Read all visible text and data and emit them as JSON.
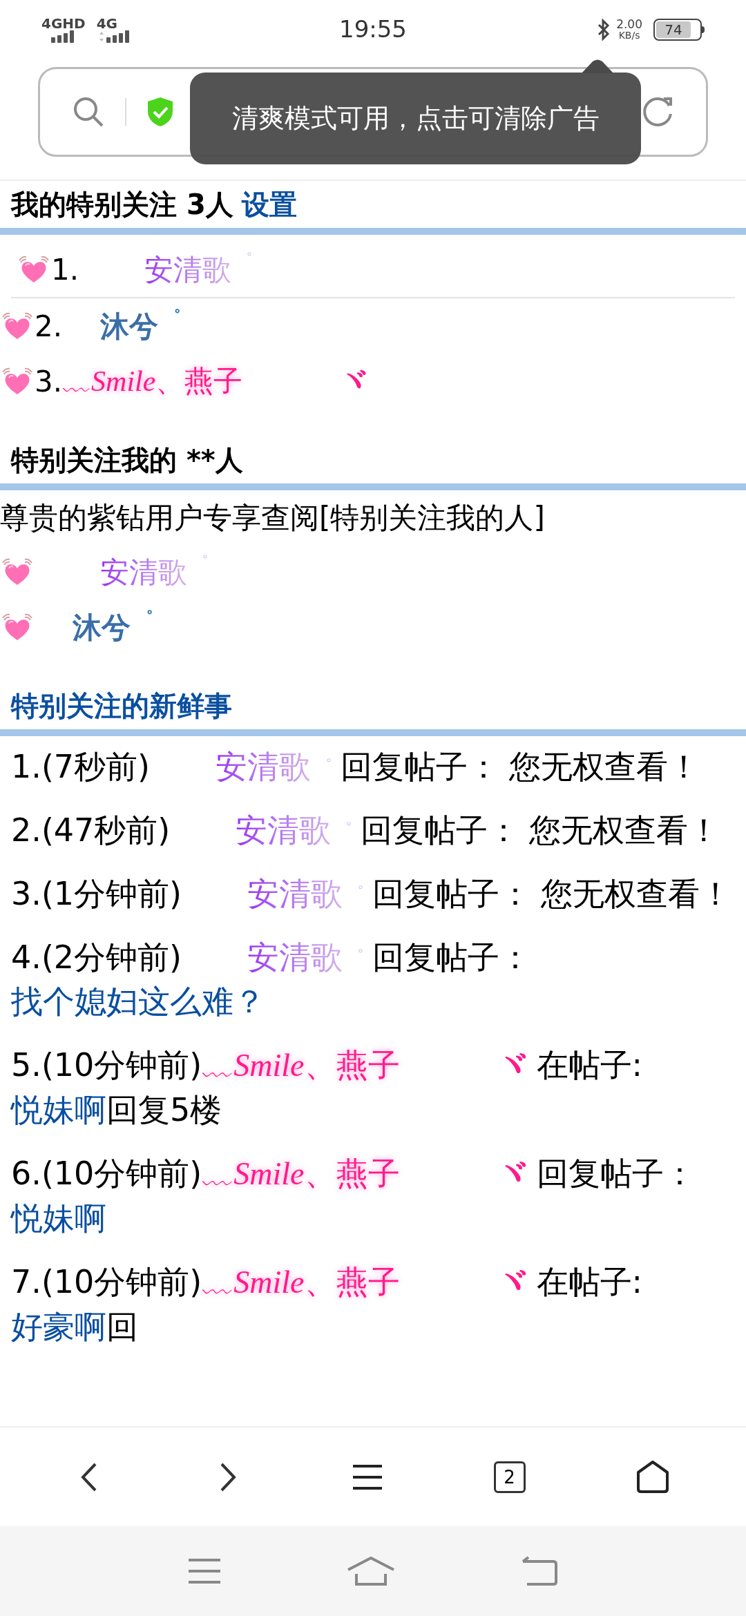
{
  "status_bar": {
    "network_1": "4GHD",
    "network_2": "4G",
    "time": "19:55",
    "speed": "2.00",
    "speed_unit": "KB/s",
    "battery": "74"
  },
  "toast": {
    "text": "清爽模式可用，点击可清除广告"
  },
  "my_follows": {
    "title": "我的特别关注 3人",
    "action": "设置",
    "items": [
      {
        "number": "1.",
        "user": {
          "name": "安清歌",
          "mark": "゜",
          "kind": "gradient"
        }
      },
      {
        "number": "2.",
        "user": {
          "name": "沐兮",
          "mark": "゜",
          "kind": "bold"
        }
      },
      {
        "number": "3.",
        "user": {
          "name": "*﹏Smile*、燕子",
          "tail": "ヾ",
          "kind": "glow"
        }
      }
    ]
  },
  "followers": {
    "title": "特别关注我的 **人",
    "notice": "尊贵的紫钻用户专享查阅[特别关注我的人]",
    "items": [
      {
        "user": {
          "name": "安清歌",
          "mark": "゜",
          "kind": "gradient"
        }
      },
      {
        "user": {
          "name": "沐兮",
          "mark": "゜",
          "kind": "bold"
        }
      }
    ]
  },
  "feed": {
    "title": "特别关注的新鲜事",
    "items": [
      {
        "index": "1.(7秒前)",
        "user": {
          "name": "安清歌",
          "mark": "゜",
          "kind": "gradient"
        },
        "action": "回复帖子：",
        "content": {
          "text": "您无权查看！",
          "kind": "plain"
        }
      },
      {
        "index": "2.(47秒前)",
        "user": {
          "name": "安清歌",
          "mark": "゜",
          "kind": "gradient"
        },
        "action": "回复帖子：",
        "content": {
          "text": "您无权查看！",
          "kind": "plain"
        }
      },
      {
        "index": "3.(1分钟前)",
        "user": {
          "name": "安清歌",
          "mark": "゜",
          "kind": "gradient"
        },
        "action": "回复帖子：",
        "content": {
          "text": "您无权查看！",
          "kind": "plain"
        }
      },
      {
        "index": "4.(2分钟前)",
        "user": {
          "name": "安清歌",
          "mark": "゜",
          "kind": "gradient"
        },
        "action": "回复帖子：",
        "content": {
          "text": "找个媳妇这么难？",
          "kind": "link"
        }
      },
      {
        "index": "5.(10分钟前)",
        "user": {
          "name": "*﹏Smile*、燕子",
          "tail": "ヾ",
          "kind": "glow"
        },
        "action": "在帖子:",
        "content": {
          "text": "悦妹啊",
          "kind": "link"
        },
        "suffix": "回复5楼"
      },
      {
        "index": "6.(10分钟前)",
        "user": {
          "name": "*﹏Smile*、燕子",
          "tail": "ヾ",
          "kind": "glow"
        },
        "action": "回复帖子：",
        "content": {
          "text": "悦妹啊",
          "kind": "link"
        }
      },
      {
        "index": "7.(10分钟前)",
        "user": {
          "name": "*﹏Smile*、燕子",
          "tail": "ヾ",
          "kind": "glow"
        },
        "action": "在帖子:",
        "content": {
          "text": "好豪啊",
          "kind": "link"
        },
        "suffix": "回"
      }
    ]
  },
  "bottom_nav": {
    "tab_count": "2"
  }
}
